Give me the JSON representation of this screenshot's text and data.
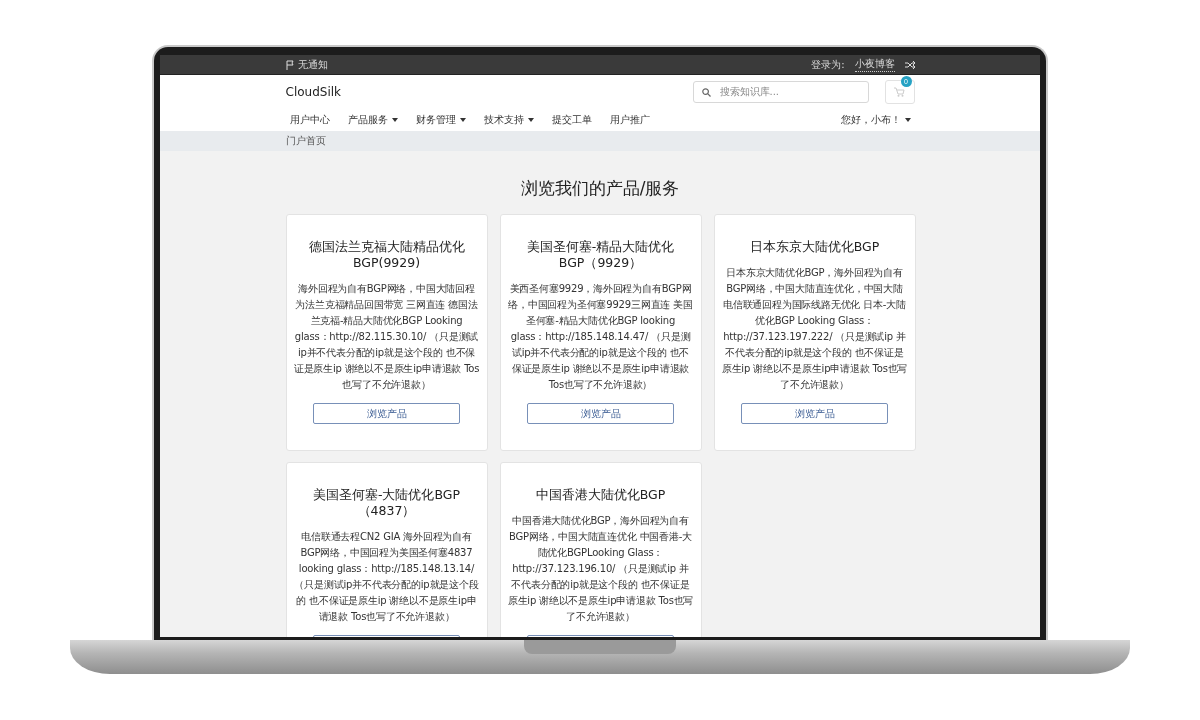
{
  "top_bar": {
    "notification": "无通知",
    "login_label": "登录为:",
    "username": "小夜博客"
  },
  "header": {
    "brand": "CloudSilk",
    "search": {
      "placeholder": "搜索知识库..."
    },
    "cart_count": "0"
  },
  "nav": {
    "items": [
      {
        "label": "用户中心",
        "dropdown": false
      },
      {
        "label": "产品服务",
        "dropdown": true
      },
      {
        "label": "财务管理",
        "dropdown": true
      },
      {
        "label": "技术支持",
        "dropdown": true
      },
      {
        "label": "提交工单",
        "dropdown": false
      },
      {
        "label": "用户推广",
        "dropdown": false
      }
    ],
    "user": {
      "label": "您好，小布！",
      "dropdown": true
    }
  },
  "breadcrumb": "门户首页",
  "heading": "浏览我们的产品/服务",
  "products": [
    {
      "title": "德国法兰克福大陆精品优化BGP(9929)",
      "description": "海外回程为自有BGP网络，中国大陆回程为法兰克福精品回国带宽 三网直连 德国法兰克福-精品大陆优化BGP Looking glass：http://82.115.30.10/ （只是测试ip并不代表分配的ip就是这个段的 也不保证是原生ip 谢绝以不是原生ip申请退款 Tos也写了不允许退款）",
      "button": "浏览产品"
    },
    {
      "title": "美国圣何塞-精品大陆优化BGP（9929）",
      "description": "美西圣何塞9929，海外回程为自有BGP网络，中国回程为圣何塞9929三网直连 美国圣何塞-精品大陆优化BGP looking glass：http://185.148.14.47/ （只是测试ip并不代表分配的ip就是这个段的 也不保证是原生ip 谢绝以不是原生ip申请退款 Tos也写了不允许退款）",
      "button": "浏览产品"
    },
    {
      "title": "日本东京大陆优化BGP",
      "description": "日本东京大陆优化BGP，海外回程为自有BGP网络，中国大陆直连优化，中国大陆电信联通回程为国际线路无优化 日本-大陆优化BGP Looking Glass：http://37.123.197.222/ （只是测试ip 并不代表分配的ip就是这个段的 也不保证是原生ip 谢绝以不是原生ip申请退款 Tos也写了不允许退款）",
      "button": "浏览产品"
    },
    {
      "title": "美国圣何塞-大陆优化BGP（4837）",
      "description": "电信联通去程CN2 GIA 海外回程为自有BGP网络，中国回程为美国圣何塞4837 looking glass：http://185.148.13.14/（只是测试ip并不代表分配的ip就是这个段的 也不保证是原生ip 谢绝以不是原生ip申请退款 Tos也写了不允许退款）"
    },
    {
      "title": "中国香港大陆优化BGP",
      "description": "中国香港大陆优化BGP，海外回程为自有BGP网络，中国大陆直连优化 中国香港-大陆优化BGPLooking Glass：http://37.123.196.10/ （只是测试ip 并不代表分配的ip就是这个段的 也不保证是原生ip 谢绝以不是原生ip申请退款 Tos也写了不允许退款）"
    }
  ]
}
